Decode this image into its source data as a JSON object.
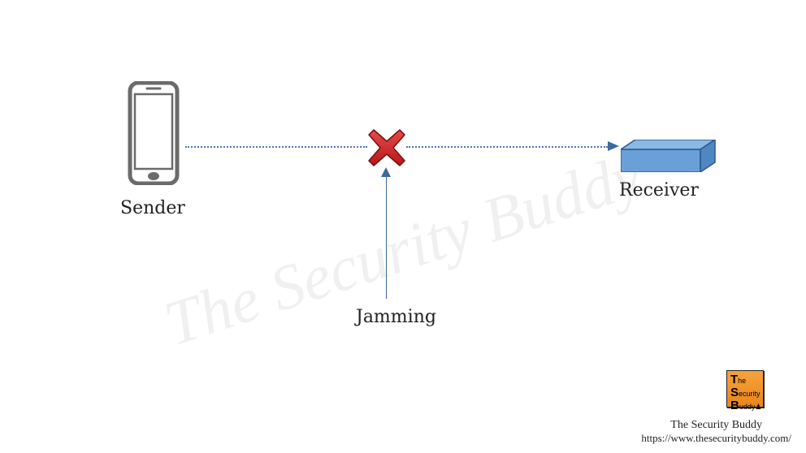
{
  "diagram": {
    "sender_label": "Sender",
    "receiver_label": "Receiver",
    "jamming_label": "Jamming"
  },
  "watermark": "The Security Buddy",
  "footer": {
    "name": "The Security Buddy",
    "url": "https://www.thesecuritybuddy.com/"
  },
  "logo": {
    "line1_initial": "T",
    "line1_rest": "he",
    "line2_initial": "S",
    "line2_rest": "ecurity",
    "line3_initial": "B",
    "line3_rest": "uddy"
  },
  "icons": {
    "phone": "smartphone-icon",
    "cross": "red-cross-icon",
    "receiver": "receiver-block-icon",
    "arrow": "arrow-right-icon",
    "jam_arrow": "arrow-up-icon"
  },
  "colors": {
    "line": "#4a77b5",
    "cross_fill": "#d32626",
    "cross_stroke": "#8e1414",
    "receiver_fill": "#5e95cc",
    "receiver_stroke": "#2b5a8a",
    "phone_stroke": "#6b6b6b"
  }
}
